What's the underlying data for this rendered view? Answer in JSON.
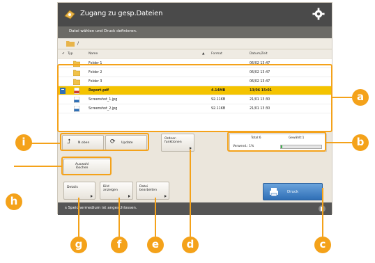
{
  "header": {
    "title": "Zugang zu gesp.Dateien",
    "instruction": "Datei wählen und Druck definieren."
  },
  "path": "/",
  "columns": {
    "type": "Typ",
    "name": "Name",
    "format": "Format",
    "date": "Datum/Zeit"
  },
  "files": [
    {
      "name": "Folder 1",
      "size": "",
      "date": "06/02  13:47",
      "kind": "folder",
      "selected": false
    },
    {
      "name": "Folder 2",
      "size": "",
      "date": "06/02  13:47",
      "kind": "folder",
      "selected": false
    },
    {
      "name": "Folder 3",
      "size": "",
      "date": "06/02  13:47",
      "kind": "folder",
      "selected": false
    },
    {
      "name": "Report.pdf",
      "size": "4.14MB",
      "date": "13/06  15:01",
      "kind": "pdf",
      "selected": true
    },
    {
      "name": "Screenshot_1.jpg",
      "size": "92.11KB",
      "date": "21/01  13:30",
      "kind": "image",
      "selected": false
    },
    {
      "name": "Screenshot_2.jpg",
      "size": "92.11KB",
      "date": "21/01  13:30",
      "kind": "image",
      "selected": false
    }
  ],
  "buttons": {
    "up": "N.oben",
    "update": "Update",
    "folder_ops": "Ordner-\nfunktionen",
    "clear_selection": "Auswahl\nlöschen",
    "details": "Details",
    "image_preview": "Bild\nanzeigen",
    "edit_file": "Datei\nbearbeiten",
    "print": "Druck"
  },
  "status": {
    "total_label": "Total:6",
    "selected_label": "Gewählt:1",
    "used_label": "Verwend.: 1%",
    "used_percent": 1
  },
  "footer": {
    "message": "s Speichermedium ist angeschlossen."
  },
  "callouts": [
    "a",
    "b",
    "c",
    "d",
    "e",
    "f",
    "g",
    "h",
    "i"
  ],
  "colors": {
    "accent": "#f4a21a",
    "selected_row": "#f4c300",
    "print_button": "#3a7bc8",
    "titlebar": "#4a4a4a"
  }
}
